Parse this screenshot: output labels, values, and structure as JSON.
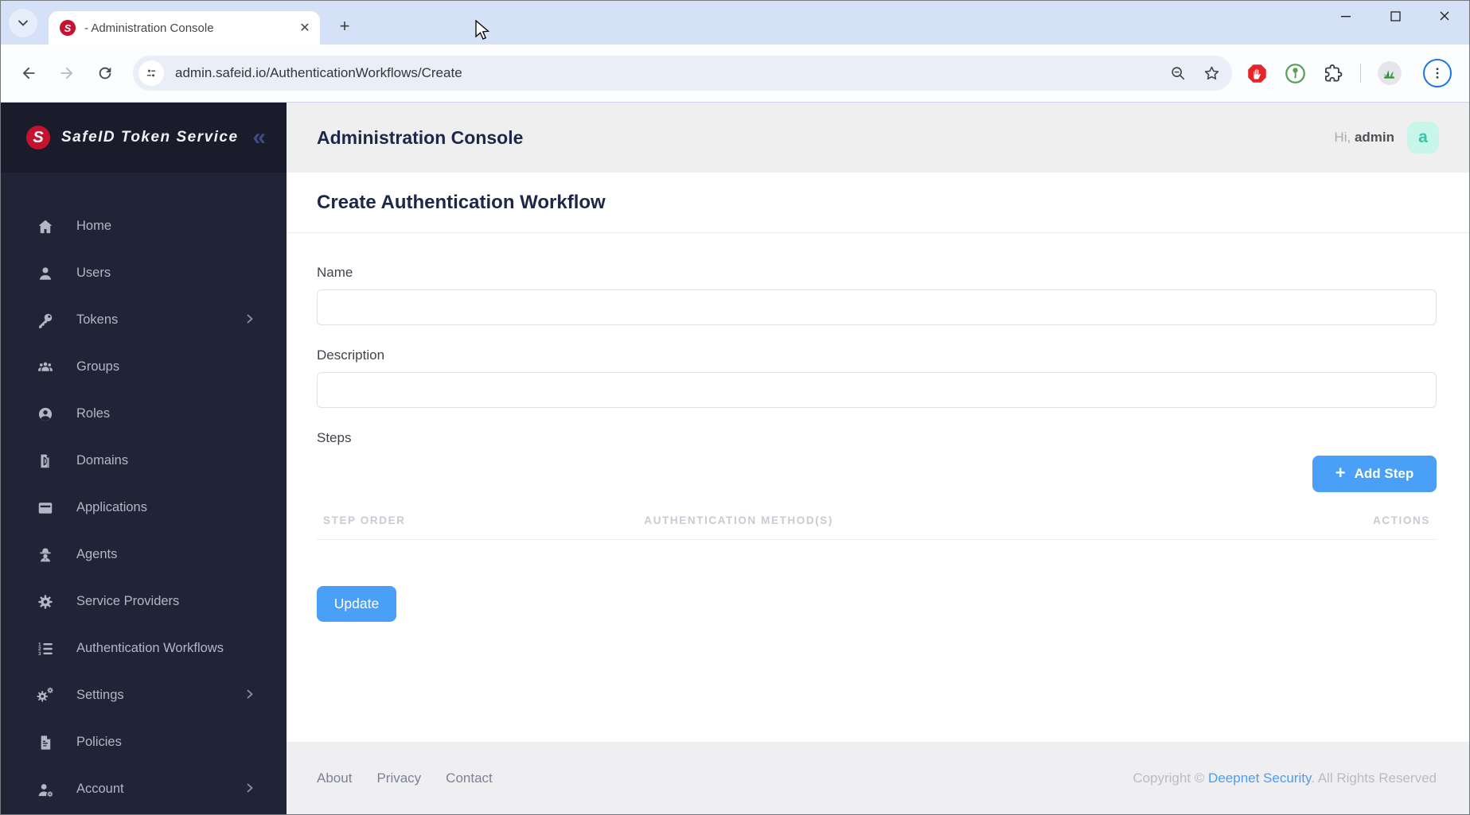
{
  "browser": {
    "tab_title": "- Administration Console",
    "favicon_letter": "S",
    "new_tab_label": "+",
    "url": "admin.safeid.io/AuthenticationWorkflows/Create",
    "accent_color": "#1a73e8"
  },
  "sidebar": {
    "brand": "SafeID Token Service",
    "brand_letter": "S",
    "collapse_glyph": "«",
    "items": [
      {
        "label": "Home",
        "icon": "home-icon",
        "has_chevron": false
      },
      {
        "label": "Users",
        "icon": "user-icon",
        "has_chevron": false
      },
      {
        "label": "Tokens",
        "icon": "key-icon",
        "has_chevron": true
      },
      {
        "label": "Groups",
        "icon": "users-group-icon",
        "has_chevron": false
      },
      {
        "label": "Roles",
        "icon": "person-circle-icon",
        "has_chevron": false
      },
      {
        "label": "Domains",
        "icon": "domain-icon",
        "has_chevron": false
      },
      {
        "label": "Applications",
        "icon": "app-window-icon",
        "has_chevron": false
      },
      {
        "label": "Agents",
        "icon": "agent-spy-icon",
        "has_chevron": false
      },
      {
        "label": "Service Providers",
        "icon": "gear-icon",
        "has_chevron": false
      },
      {
        "label": "Authentication Workflows",
        "icon": "ordered-list-icon",
        "has_chevron": false
      },
      {
        "label": "Settings",
        "icon": "gears-icon",
        "has_chevron": true
      },
      {
        "label": "Policies",
        "icon": "policy-document-icon",
        "has_chevron": false
      },
      {
        "label": "Account",
        "icon": "user-gear-icon",
        "has_chevron": true
      }
    ],
    "colors": {
      "background": "#212336",
      "logo_red": "#c4122f"
    }
  },
  "header": {
    "title": "Administration Console",
    "greeting_prefix": "Hi,",
    "username": "admin",
    "avatar_letter": "a",
    "avatar_bg": "#c8f6eb",
    "avatar_fg": "#38c5a7"
  },
  "page": {
    "title": "Create Authentication Workflow",
    "form": {
      "name_label": "Name",
      "name_value": "",
      "description_label": "Description",
      "description_value": "",
      "steps_label": "Steps",
      "add_step_label": "Add Step",
      "add_step_plus": "+",
      "update_label": "Update",
      "table_headers": [
        "STEP ORDER",
        "AUTHENTICATION METHOD(S)",
        "ACTIONS"
      ],
      "button_color": "#4aa0f6"
    }
  },
  "footer": {
    "links": [
      "About",
      "Privacy",
      "Contact"
    ],
    "copyright_prefix": "Copyright © ",
    "copyright_link": "Deepnet Security",
    "copyright_suffix": ". All Rights Reserved"
  }
}
